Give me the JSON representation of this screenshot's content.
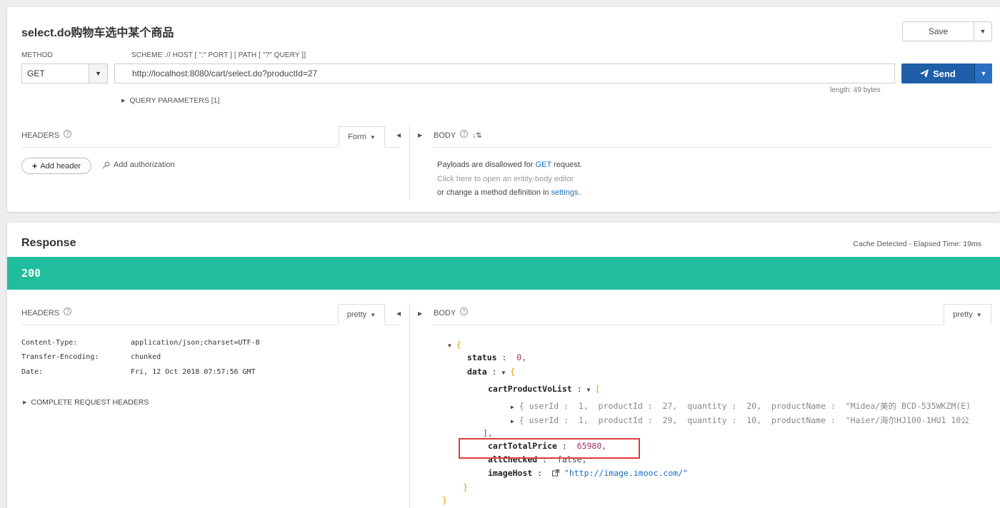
{
  "request": {
    "title": "select.do购物车选中某个商品",
    "save_label": "Save",
    "method_label": "METHOD",
    "method_value": "GET",
    "url_label": "SCHEME :// HOST [ \":\" PORT ] [ PATH [ \"?\" QUERY ]]",
    "url_value": "http://localhost:8080/cart/select.do?productId=27",
    "send_label": "Send",
    "length_note": "length: 49 bytes",
    "query_params_label": "QUERY PARAMETERS [1]",
    "headers_label": "HEADERS",
    "headers_mode": "Form",
    "body_label": "BODY",
    "add_header_label": "Add header",
    "add_auth_label": "Add authorization",
    "payload_line1_pre": "Payloads are disallowed for ",
    "payload_line1_method": "GET",
    "payload_line1_post": " request.",
    "payload_line2": "Click here to open an entity-body editor",
    "payload_line3_pre": "or change a method definition in ",
    "payload_line3_link": "settings",
    "payload_line3_post": "."
  },
  "response": {
    "title": "Response",
    "cache_note": "Cache Detected - Elapsed Time: 19ms",
    "status_code": "200",
    "status_color": "#21be9d",
    "headers_label": "HEADERS",
    "headers_mode": "pretty",
    "body_label": "BODY",
    "body_mode": "pretty",
    "headers": [
      {
        "key": "Content-Type:",
        "value": "application/json;charset=UTF-8"
      },
      {
        "key": "Transfer-Encoding:",
        "value": "chunked"
      },
      {
        "key": "Date:",
        "value": "Fri, 12 Oct 2018 07:57:56 GMT"
      }
    ],
    "complete_headers_label": "COMPLETE REQUEST HEADERS",
    "body": {
      "status_key": "status",
      "status_val": "0,",
      "data_key": "data",
      "list_key": "cartProductVoList",
      "item1": "{ userId :  1,  productId :  27,  quantity :  20,  productName :  \"Midea/美的 BCD-535WKZM(E)",
      "item2": "{ userId :  1,  productId :  29,  quantity :  10,  productName :  \"Haier/海尔HJ100-1HU1 10公",
      "total_key": "cartTotalPrice",
      "total_val": "65980,",
      "checked_key": "allChecked",
      "checked_val": "false,",
      "host_key": "imageHost",
      "host_val": "\"http://image.imooc.com/\""
    }
  },
  "colors": {
    "send_button": "#1e5fa8",
    "highlight_box": "#e13a3a",
    "link": "#1e6fb8"
  }
}
